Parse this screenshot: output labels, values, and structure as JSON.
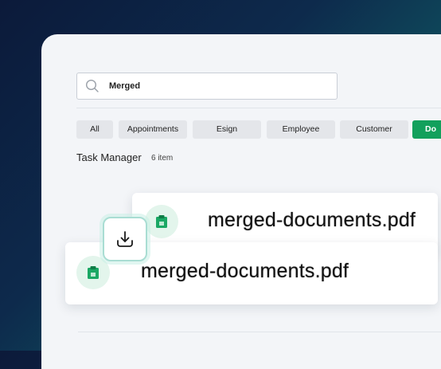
{
  "search": {
    "value": "Merged"
  },
  "filters": [
    {
      "label": "All"
    },
    {
      "label": "Appointments"
    },
    {
      "label": "Esign"
    },
    {
      "label": "Employee"
    },
    {
      "label": "Customer"
    },
    {
      "label": "Do"
    }
  ],
  "task_manager": {
    "title": "Task Manager",
    "count": "6 item"
  },
  "files": [
    {
      "name": "merged-documents.pdf"
    },
    {
      "name": "merged-documents.pdf"
    }
  ],
  "colors": {
    "accent": "#12a05c",
    "file_icon_bg": "#e3f5ec",
    "download_border": "#a9ddd3"
  },
  "icons": [
    "search-icon",
    "clipboard-icon",
    "download-icon"
  ]
}
